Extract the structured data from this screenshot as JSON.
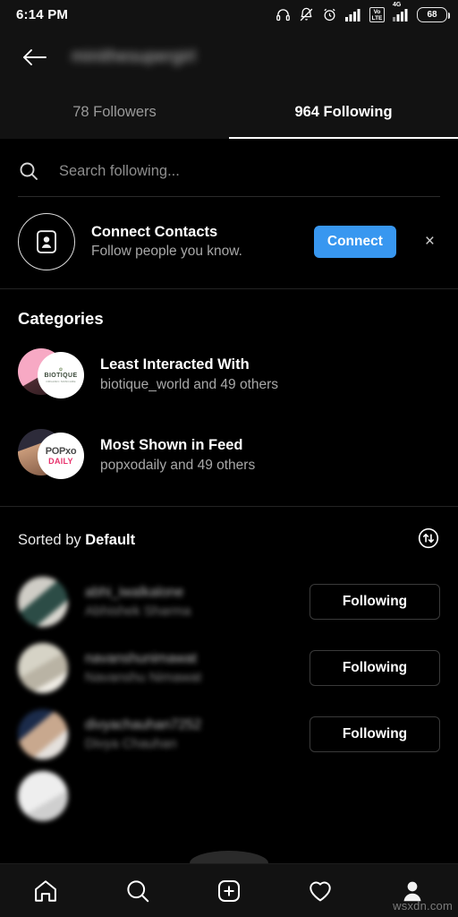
{
  "status_bar": {
    "time": "6:14 PM",
    "battery_level": "68",
    "volte_top": "Vo",
    "volte_bottom": "LTE",
    "network_label": "4G",
    "icons": [
      "headphones-icon",
      "bell-off-icon",
      "alarm-clock-icon",
      "signal-bars-icon",
      "volte-icon",
      "4g-signal-icon",
      "battery-icon"
    ]
  },
  "header": {
    "back_label": "Back",
    "username": "minithesupergirl"
  },
  "tabs": [
    {
      "label": "78 Followers",
      "active": false
    },
    {
      "label": "964 Following",
      "active": true
    }
  ],
  "search": {
    "placeholder": "Search following...",
    "value": ""
  },
  "connect_contacts": {
    "title": "Connect Contacts",
    "subtitle": "Follow people you know.",
    "button_label": "Connect",
    "button_color": "#3897f0",
    "dismiss_label": "×"
  },
  "categories": {
    "heading": "Categories",
    "items": [
      {
        "title": "Least Interacted With",
        "subtitle": "biotique_world and 49 others",
        "avatar_front_text_top": "BIOTIQUE",
        "avatar_front_text_bottom": "ORGANIC SKINCARE"
      },
      {
        "title": "Most Shown in Feed",
        "subtitle": "popxodaily and 49 others",
        "avatar_front_text_top": "POPxo",
        "avatar_front_text_bottom": "DAILY"
      }
    ]
  },
  "sort": {
    "prefix": "Sorted by ",
    "value": "Default",
    "icon": "sort-arrows-icon"
  },
  "following_list": [
    {
      "handle": "abhi_iwalkalone",
      "name": "Abhishek Sharma",
      "button_label": "Following"
    },
    {
      "handle": "navanshunimawat",
      "name": "Navanshu Nimawat",
      "button_label": "Following"
    },
    {
      "handle": "divyachauhan7252",
      "name": "Divya Chauhan",
      "button_label": "Following"
    }
  ],
  "bottom_nav": [
    {
      "name": "home",
      "label": "Home"
    },
    {
      "name": "search",
      "label": "Search"
    },
    {
      "name": "create",
      "label": "Create"
    },
    {
      "name": "activity",
      "label": "Activity"
    },
    {
      "name": "profile",
      "label": "Profile"
    }
  ],
  "watermark": "wsxdn.com"
}
